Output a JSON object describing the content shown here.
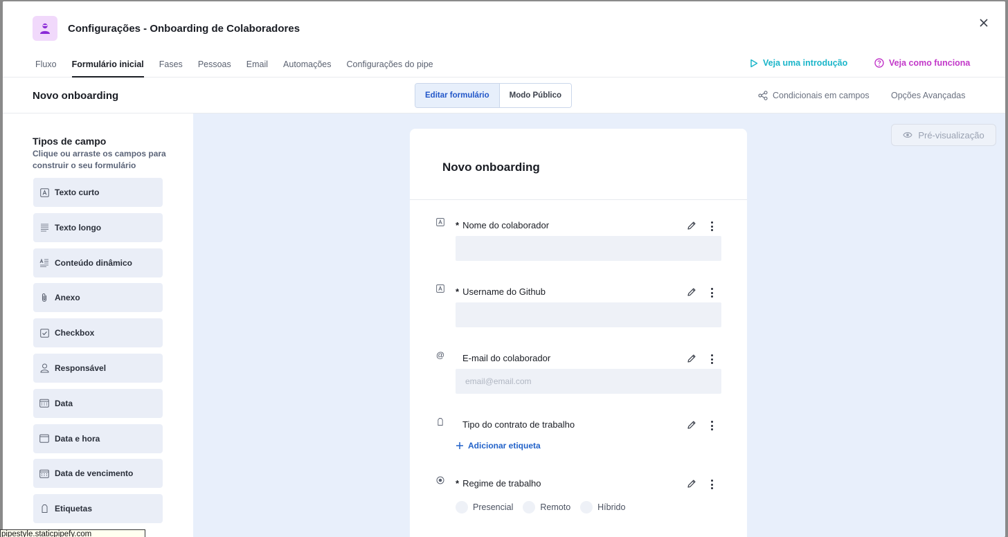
{
  "header": {
    "title": "Configurações - Onboarding de Colaboradores",
    "tabs": [
      {
        "label": "Fluxo"
      },
      {
        "label": "Formulário inicial"
      },
      {
        "label": "Fases"
      },
      {
        "label": "Pessoas"
      },
      {
        "label": "Email"
      },
      {
        "label": "Automações"
      },
      {
        "label": "Configurações do pipe"
      }
    ],
    "intro_link": "Veja uma introdução",
    "how_link": "Veja como funciona"
  },
  "toolbar": {
    "form_name": "Novo onboarding",
    "edit_form": "Editar formulário",
    "public_mode": "Modo Público",
    "conditionals": "Condicionais em campos",
    "advanced": "Opções Avançadas"
  },
  "sidebar": {
    "title": "Tipos de campo",
    "subtitle": "Clique ou arraste os campos para construir o seu formulário",
    "items": [
      {
        "label": "Texto curto",
        "icon": "short-text-icon"
      },
      {
        "label": "Texto longo",
        "icon": "long-text-icon"
      },
      {
        "label": "Conteúdo dinâmico",
        "icon": "dynamic-content-icon"
      },
      {
        "label": "Anexo",
        "icon": "paperclip-icon"
      },
      {
        "label": "Checkbox",
        "icon": "checkbox-icon"
      },
      {
        "label": "Responsável",
        "icon": "user-icon"
      },
      {
        "label": "Data",
        "icon": "calendar-icon"
      },
      {
        "label": "Data e hora",
        "icon": "datetime-icon"
      },
      {
        "label": "Data de vencimento",
        "icon": "due-date-icon"
      },
      {
        "label": "Etiquetas",
        "icon": "tag-icon"
      }
    ]
  },
  "canvas": {
    "preview": "Pré-visualização",
    "form_title": "Novo onboarding",
    "fields": [
      {
        "label": "Nome do colaborador",
        "required": "*",
        "placeholder": ""
      },
      {
        "label": "Username do Github",
        "required": "*",
        "placeholder": ""
      },
      {
        "label": "E-mail do colaborador",
        "required": "",
        "placeholder": "email@email.com"
      },
      {
        "label": "Tipo do contrato de trabalho",
        "required": "",
        "add_tag": "Adicionar etiqueta"
      },
      {
        "label": "Regime de trabalho",
        "required": "*",
        "options": [
          "Presencial",
          "Remoto",
          "Híbrido"
        ]
      }
    ]
  },
  "status_bar": "pipestyle.staticpipefy.com",
  "colors": {
    "accent_blue": "#2262c9",
    "intro_teal": "#1ab5c9",
    "how_magenta": "#c238c9",
    "canvas_bg": "#e8effb"
  }
}
